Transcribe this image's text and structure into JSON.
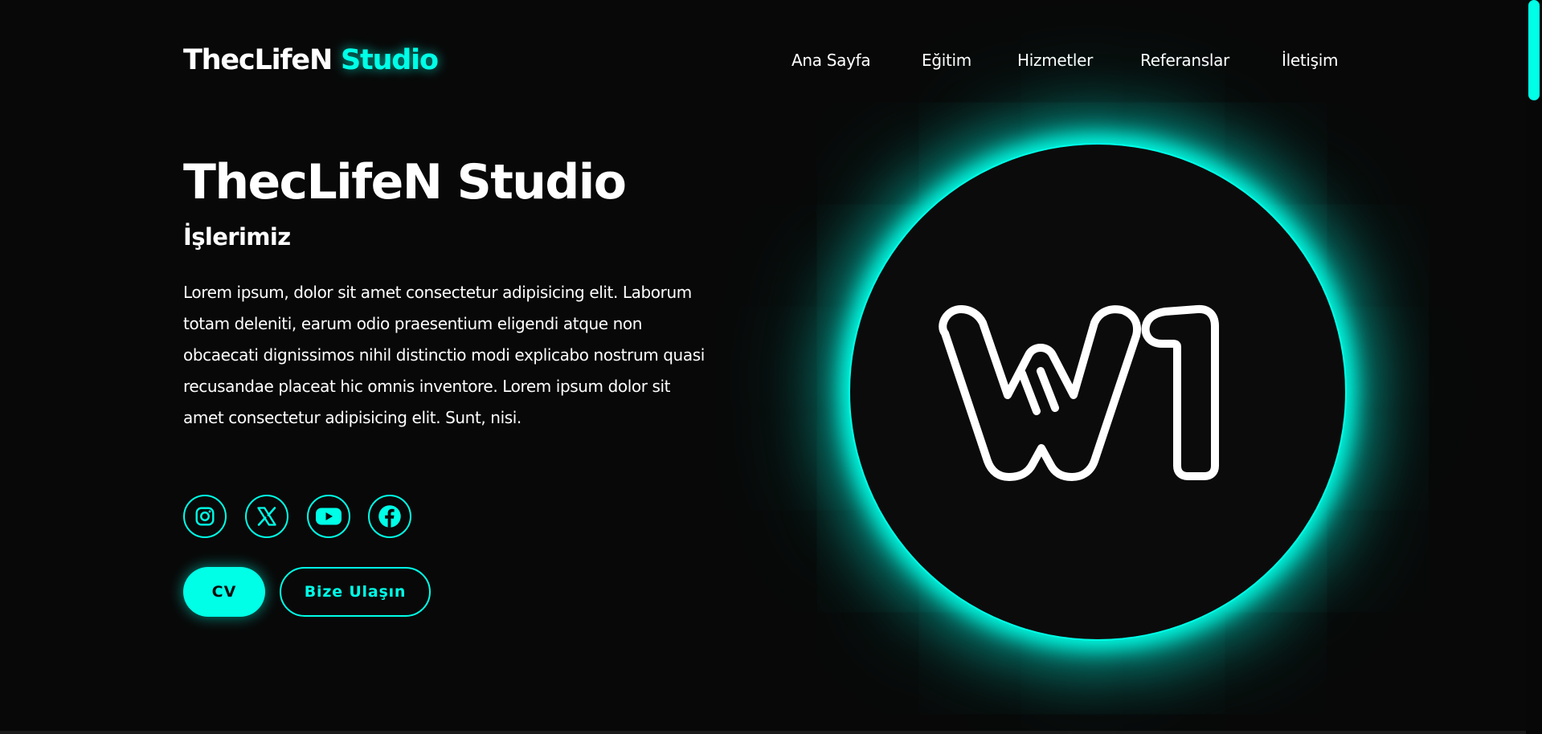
{
  "header": {
    "logo_main": "ThecLifeN",
    "logo_accent": "Studio",
    "nav": [
      {
        "label": "Ana Sayfa"
      },
      {
        "label": "Eğitim"
      },
      {
        "label": "Hizmetler"
      },
      {
        "label": "Referanslar"
      },
      {
        "label": "İletişim"
      }
    ]
  },
  "hero": {
    "title": "ThecLifeN Studio",
    "subtitle": "İşlerimiz",
    "description": "Lorem ipsum, dolor sit amet consectetur adipisicing elit. Laborum totam deleniti, earum odio praesentium eligendi atque non obcaecati dignissimos nihil distinctio modi explicabo nostrum quasi recusandae placeat hic omnis inventore. Lorem ipsum dolor sit amet consectetur adipisicing elit. Sunt, nisi.",
    "socials": [
      {
        "icon": "instagram-icon"
      },
      {
        "icon": "x-twitter-icon"
      },
      {
        "icon": "youtube-icon"
      },
      {
        "icon": "facebook-icon"
      }
    ],
    "cv_button": "CV",
    "contact_button": "Bize Ulaşın",
    "emblem_text": "W1"
  },
  "colors": {
    "accent": "#00ffe7",
    "background": "#080808",
    "text": "#ffffff"
  }
}
